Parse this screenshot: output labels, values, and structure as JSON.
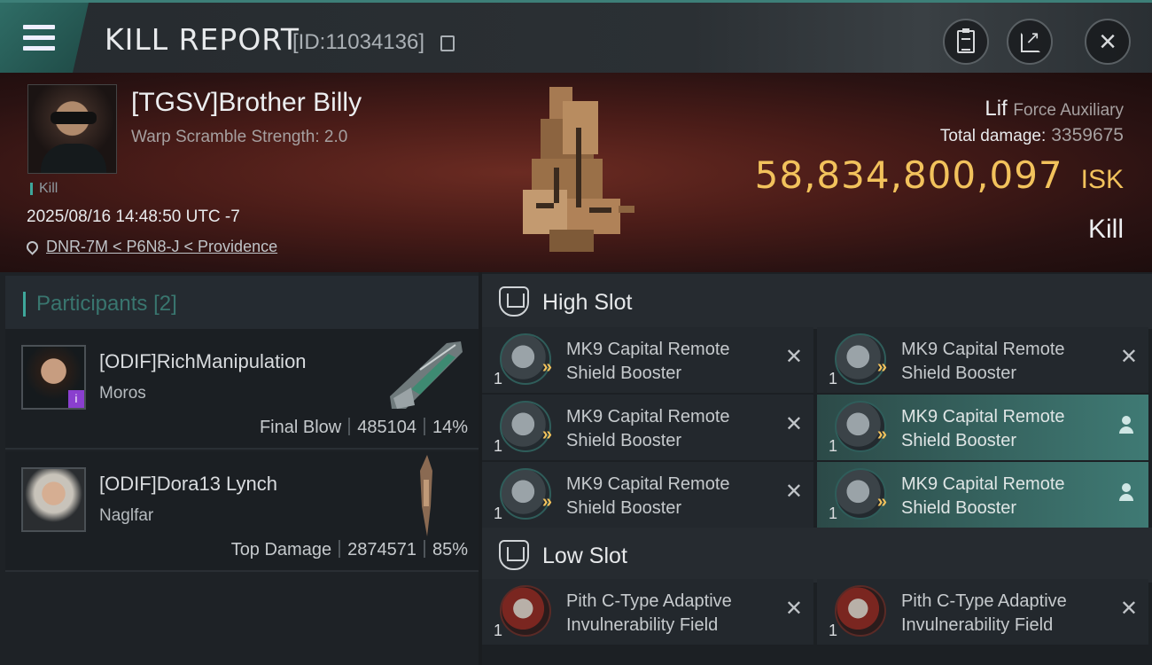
{
  "header": {
    "title": "KILL REPORT",
    "id_label": "[ID:11034136]",
    "icons": [
      "menu-icon",
      "copy-icon",
      "clipboard-icon",
      "share-icon",
      "close-icon"
    ]
  },
  "victim": {
    "name": "[TGSV]Brother Billy",
    "subtitle": "Warp Scramble Strength: 2.0",
    "kill_tag": "Kill",
    "timestamp": "2025/08/16 14:48:50 UTC -7",
    "location": "DNR-7M < P6N8-J < Providence",
    "ship_name": "Lif",
    "ship_class": "Force Auxiliary",
    "total_damage_label": "Total damage:",
    "total_damage": "3359675",
    "isk_value": "58,834,800,097",
    "isk_unit": "ISK",
    "result": "Kill"
  },
  "participants": {
    "title": "Participants",
    "count": "[2]",
    "items": [
      {
        "name": "[ODIF]RichManipulation",
        "ship": "Moros",
        "role": "Final Blow",
        "damage": "485104",
        "percent": "14%",
        "badge": "i"
      },
      {
        "name": "[ODIF]Dora13 Lynch",
        "ship": "Naglfar",
        "role": "Top Damage",
        "damage": "2874571",
        "percent": "85%"
      }
    ]
  },
  "fitting": {
    "high_slot": {
      "title": "High Slot",
      "modules": [
        {
          "qty": "1",
          "name": "MK9 Capital Remote Shield Booster",
          "status": "destroyed"
        },
        {
          "qty": "1",
          "name": "MK9 Capital Remote Shield Booster",
          "status": "destroyed"
        },
        {
          "qty": "1",
          "name": "MK9 Capital Remote Shield Booster",
          "status": "destroyed"
        },
        {
          "qty": "1",
          "name": "MK9 Capital Remote Shield Booster",
          "status": "dropped"
        },
        {
          "qty": "1",
          "name": "MK9 Capital Remote Shield Booster",
          "status": "destroyed"
        },
        {
          "qty": "1",
          "name": "MK9 Capital Remote Shield Booster",
          "status": "dropped"
        }
      ]
    },
    "low_slot": {
      "title": "Low Slot",
      "modules": [
        {
          "qty": "1",
          "name": "Pith C-Type Adaptive Invulnerability Field",
          "status": "destroyed"
        },
        {
          "qty": "1",
          "name": "Pith C-Type Adaptive Invulnerability Field",
          "status": "destroyed"
        }
      ]
    }
  },
  "colors": {
    "accent": "#3ea79b",
    "isk": "#f2c25c",
    "dropped_highlight": "#3f7a74",
    "banner": "#4a1c18"
  }
}
